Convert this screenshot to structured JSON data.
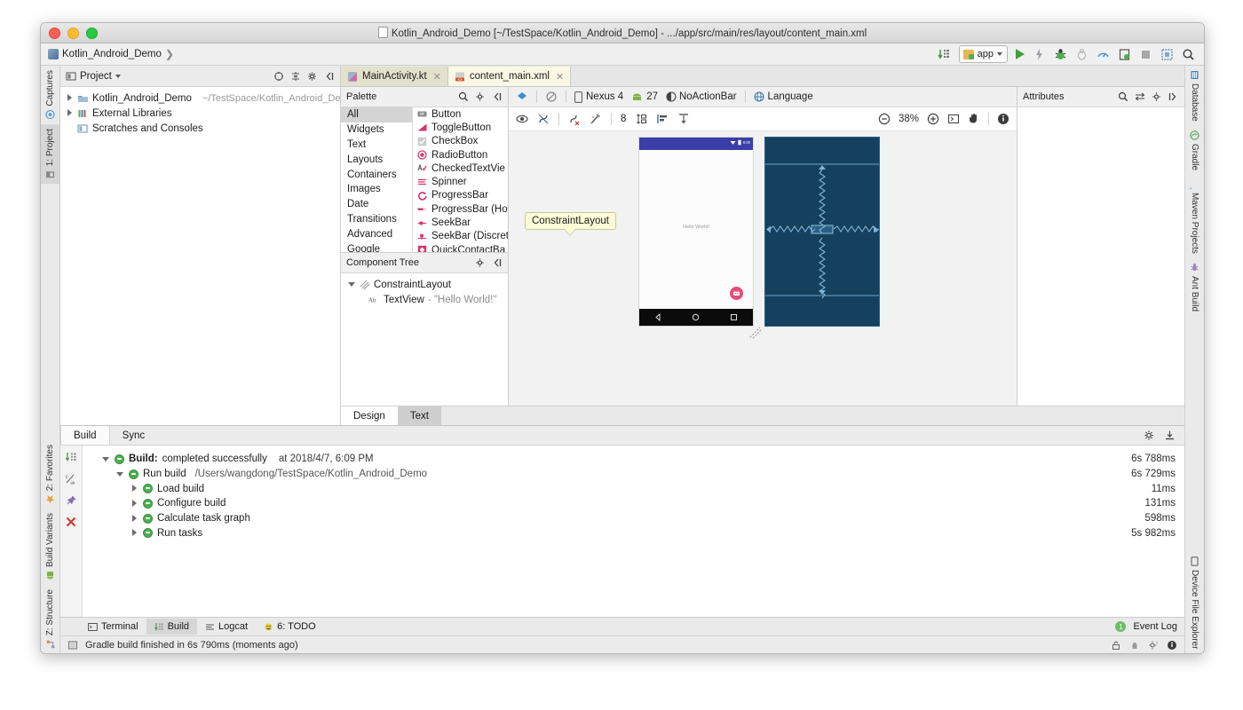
{
  "window": {
    "title": "Kotlin_Android_Demo [~/TestSpace/Kotlin_Android_Demo] - .../app/src/main/res/layout/content_main.xml"
  },
  "breadcrumb": {
    "project": "Kotlin_Android_Demo",
    "separator": "❯"
  },
  "toolbar": {
    "run_config": "app",
    "icons": [
      "sync-gradle-icon",
      "run-icon",
      "apply-changes-icon",
      "debug-icon",
      "coverage-icon",
      "profiler-icon",
      "device-manager-icon",
      "stop-icon",
      "layout-inspector-icon",
      "search-everywhere-icon"
    ]
  },
  "left_strip": {
    "top": [
      {
        "label": "Captures",
        "icon": "captures-icon",
        "active": false
      },
      {
        "label": "1: Project",
        "icon": "project-icon",
        "active": true
      }
    ],
    "bottom": [
      {
        "label": "2: Favorites",
        "icon": "star-icon",
        "active": false
      },
      {
        "label": "Build Variants",
        "icon": "android-icon",
        "active": false
      },
      {
        "label": "Z: Structure",
        "icon": "structure-icon",
        "active": false
      }
    ]
  },
  "right_strip": {
    "top": [
      {
        "label": "Database",
        "icon": "database-icon"
      },
      {
        "label": "Gradle",
        "icon": "gradle-icon"
      },
      {
        "label": "Maven Projects",
        "icon": "maven-icon"
      },
      {
        "label": "Ant Build",
        "icon": "ant-icon"
      }
    ],
    "bottom": [
      {
        "label": "Device File Explorer",
        "icon": "device-file-icon"
      }
    ]
  },
  "project_panel": {
    "title": "Project",
    "actions": [
      "target-icon",
      "collapse-icon",
      "gear-icon",
      "hide-icon"
    ],
    "tree": [
      {
        "label": "Kotlin_Android_Demo",
        "sub": "~/TestSpace/Kotlin_Android_De",
        "twisty": "closed",
        "icon": "module-icon",
        "indent": 0
      },
      {
        "label": "External Libraries",
        "sub": "",
        "twisty": "closed",
        "icon": "libraries-icon",
        "indent": 0
      },
      {
        "label": "Scratches and Consoles",
        "sub": "",
        "twisty": "none",
        "icon": "scratches-icon",
        "indent": 0
      }
    ]
  },
  "editor_tabs": [
    {
      "label": "MainActivity.kt",
      "type": "kt",
      "active": false
    },
    {
      "label": "content_main.xml",
      "type": "xml",
      "active": true
    }
  ],
  "palette": {
    "title": "Palette",
    "actions": [
      "search-icon",
      "gear-icon",
      "hide-icon"
    ],
    "categories": [
      "All",
      "Widgets",
      "Text",
      "Layouts",
      "Containers",
      "Images",
      "Date",
      "Transitions",
      "Advanced",
      "Google"
    ],
    "selected_category": "All",
    "items": [
      {
        "label": "Button",
        "icon": "button-icon"
      },
      {
        "label": "ToggleButton",
        "icon": "togglebutton-icon"
      },
      {
        "label": "CheckBox",
        "icon": "checkbox-icon"
      },
      {
        "label": "RadioButton",
        "icon": "radiobutton-icon"
      },
      {
        "label": "CheckedTextVie",
        "icon": "checkedtextview-icon"
      },
      {
        "label": "Spinner",
        "icon": "spinner-icon"
      },
      {
        "label": "ProgressBar",
        "icon": "progressbar-icon"
      },
      {
        "label": "ProgressBar (Ho",
        "icon": "progressbar-horizontal-icon"
      },
      {
        "label": "SeekBar",
        "icon": "seekbar-icon"
      },
      {
        "label": "SeekBar (Discret",
        "icon": "seekbar-discrete-icon"
      },
      {
        "label": "QuickContactBa",
        "icon": "quickcontactbadge-icon"
      }
    ]
  },
  "component_tree": {
    "title": "Component Tree",
    "actions": [
      "gear-icon",
      "hide-icon"
    ],
    "nodes": [
      {
        "label": "ConstraintLayout",
        "value": "",
        "icon": "constraintlayout-icon",
        "twisty": "open",
        "indent": 0
      },
      {
        "label": "TextView",
        "value": "- \"Hello World!\"",
        "icon": "textview-icon",
        "twisty": "none",
        "indent": 1
      }
    ]
  },
  "surface_toolbar": {
    "design_mode_icon": "design-surface-icon",
    "blueprint_icon": "blueprint-toggle-icon",
    "device": "Nexus 4",
    "api_level": "27",
    "theme": "NoActionBar",
    "locale": "Language"
  },
  "surface_toolbar2": {
    "left_icons": [
      "show-constraints-icon",
      "autoconnect-off-icon",
      "clear-constraints-icon",
      "infer-constraints-icon"
    ],
    "margin_value": "8",
    "more_icons": [
      "pack-icon",
      "align-icon",
      "guidelines-icon"
    ],
    "zoom_out_icon": "zoom-out-icon",
    "zoom": "38%",
    "zoom_in_icon": "zoom-in-icon",
    "zoom_fit_icon": "zoom-fit-icon",
    "pan_icon": "pan-hand-icon",
    "info_icon": "info-icon"
  },
  "preview": {
    "tooltip": "ConstraintLayout",
    "status_time": "6:00",
    "hello_text": "Hello World!"
  },
  "attributes_panel": {
    "title": "Attributes",
    "actions": [
      "search-icon",
      "swap-icon",
      "gear-icon",
      "hide-icon"
    ]
  },
  "editor_mode_tabs": [
    {
      "label": "Design",
      "active": true
    },
    {
      "label": "Text",
      "active": false
    }
  ],
  "build_panel": {
    "tabs": [
      {
        "label": "Build",
        "active": true
      },
      {
        "label": "Sync",
        "active": false
      }
    ],
    "actions": [
      "gear-icon",
      "export-icon"
    ],
    "gutter_icons": [
      "expand-all-icon",
      "soft-wrap-icon",
      "pin-icon",
      "close-icon"
    ],
    "rows": [
      {
        "label": "Build:",
        "detail": "completed successfully",
        "extra": "at 2018/4/7, 6:09 PM",
        "time": "6s 788ms",
        "twisty": "open",
        "indent": 0,
        "bold": true
      },
      {
        "label": "Run build",
        "detail": "",
        "extra": "/Users/wangdong/TestSpace/Kotlin_Android_Demo",
        "time": "6s 729ms",
        "twisty": "open",
        "indent": 1,
        "bold": false
      },
      {
        "label": "Load build",
        "detail": "",
        "extra": "",
        "time": "11ms",
        "twisty": "closed",
        "indent": 2,
        "bold": false
      },
      {
        "label": "Configure build",
        "detail": "",
        "extra": "",
        "time": "131ms",
        "twisty": "closed",
        "indent": 2,
        "bold": false
      },
      {
        "label": "Calculate task graph",
        "detail": "",
        "extra": "",
        "time": "598ms",
        "twisty": "closed",
        "indent": 2,
        "bold": false
      },
      {
        "label": "Run tasks",
        "detail": "",
        "extra": "",
        "time": "5s 982ms",
        "twisty": "closed",
        "indent": 2,
        "bold": false
      }
    ]
  },
  "bottom_tool_tabs": [
    {
      "label": "Terminal",
      "icon": "terminal-icon",
      "active": false
    },
    {
      "label": "Build",
      "icon": "build-icon",
      "active": true
    },
    {
      "label": "Logcat",
      "icon": "logcat-icon",
      "active": false
    },
    {
      "label": "6: TODO",
      "icon": "todo-icon",
      "active": false
    }
  ],
  "event_log": {
    "label": "Event Log",
    "count": "1"
  },
  "statusbar": {
    "message": "Gradle build finished in 6s 790ms (moments ago)",
    "right_icons": [
      "lock-icon",
      "memory-icon",
      "settings-icon",
      "notifications-icon"
    ]
  },
  "colors": {
    "accent_blue": "#3a3fa8",
    "blueprint": "#15405e",
    "fab_pink": "#e84a7a",
    "success_green": "#4caf50",
    "tooltip_yellow": "#fbfbd8"
  }
}
